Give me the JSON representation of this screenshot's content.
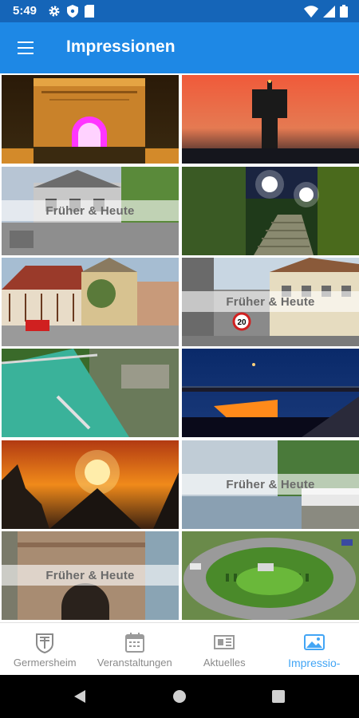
{
  "status_bar": {
    "time": "5:49"
  },
  "app_bar": {
    "title": "Impressionen",
    "menu_icon": "hamburger-menu-icon"
  },
  "tiles": {
    "t3": {
      "caption": "Früher & Heute"
    },
    "t6": {
      "caption": "Früher & Heute"
    },
    "t10": {
      "caption": "Früher & Heute"
    },
    "t11": {
      "caption": "Früher & Heute"
    }
  },
  "sign_value": "20",
  "bottom_nav": {
    "germersheim": "Germersheim",
    "veranstaltungen": "Veranstaltungen",
    "aktuelles": "Aktuelles",
    "impressionen": "Impressio-"
  },
  "colors": {
    "status_bar": "#1565b8",
    "app_bar": "#1e88e5",
    "active_tab": "#42a5f5"
  }
}
